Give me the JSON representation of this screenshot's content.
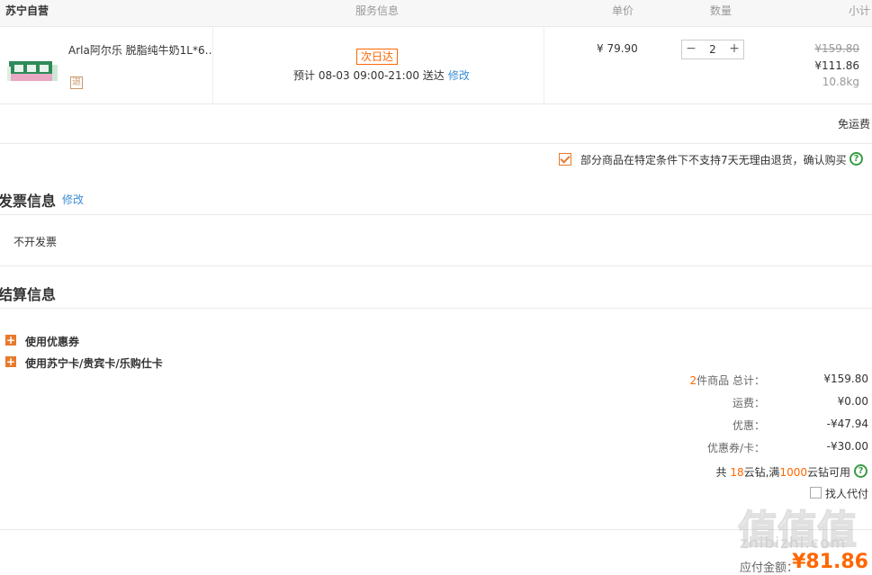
{
  "header": {
    "store_name": "苏宁自营",
    "col_service": "服务信息",
    "col_price": "单价",
    "col_qty": "数量",
    "col_subtotal": "小计"
  },
  "product": {
    "name": "Arla阿尔乐 脱脂纯牛奶1L*6…",
    "return_badge": "退",
    "delivery_badge": "次日达",
    "delivery_text": "预计 08-03 09:00-21:00 送达",
    "delivery_edit": "修改",
    "unit_price": "¥ 79.90",
    "qty_minus": "−",
    "qty_plus": "+",
    "qty": "2",
    "original_total": "¥159.80",
    "sale_total": "¥111.86",
    "weight": "10.8kg"
  },
  "shipping": {
    "label": "免运费"
  },
  "confirm": {
    "text": "部分商品在特定条件下不支持7天无理由退货，确认购买",
    "checked": true,
    "help": "?"
  },
  "invoice": {
    "title": "发票信息",
    "edit": "修改",
    "value": "不开发票"
  },
  "settlement": {
    "title": "结算信息",
    "promos": [
      {
        "icon": "+",
        "label": "使用优惠券"
      },
      {
        "icon": "+",
        "label": "使用苏宁卡/贵宾卡/乐购仕卡"
      }
    ],
    "summary": {
      "count": "2",
      "count_suffix": "件商品 总计：",
      "total": "¥159.80",
      "shipping_label": "运费：",
      "shipping_value": "¥0.00",
      "discount_label": "优惠：",
      "discount_value": "-¥47.94",
      "coupon_label": "优惠券/卡：",
      "coupon_value": "-¥30.00"
    },
    "diamonds": {
      "prefix": "共 ",
      "count": "18",
      "mid": "云钻,满",
      "threshold": "1000",
      "suffix": "云钻可用",
      "help": "?"
    },
    "pay_for_label": "找人代付",
    "payable_label": "应付金额：",
    "payable_value": "¥81.86"
  },
  "watermark": {
    "text": "zhibizhi.com",
    "logo": "值值值"
  },
  "colors": {
    "accent": "#ff6600",
    "link": "#3b8dd8",
    "help_green": "#3a9b47"
  }
}
